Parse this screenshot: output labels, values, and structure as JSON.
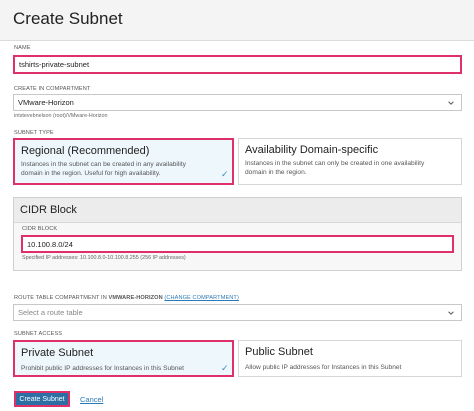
{
  "header": {
    "title": "Create Subnet"
  },
  "name": {
    "label": "NAME",
    "value": "tshirts-private-subnet"
  },
  "compartment": {
    "label": "CREATE IN COMPARTMENT",
    "value": "VMware-Horizon",
    "path": "intstevebnelson (root)/VMware-Horizon"
  },
  "subnet_type": {
    "label": "SUBNET TYPE",
    "options": [
      {
        "title": "Regional (Recommended)",
        "desc_1": "Instances in the subnet can be created in any availability",
        "desc_2": "domain in the region. Useful for high availability.",
        "selected": true
      },
      {
        "title": "Availability Domain-specific",
        "desc_1": "Instances in the subnet can only be created in one availability",
        "desc_2": "domain in the region.",
        "selected": false
      }
    ]
  },
  "cidr": {
    "section_title": "CIDR Block",
    "label": "CIDR BLOCK",
    "value": "10.100.8.0/24",
    "hint": "Specified IP addresses: 10.100.8.0-10.100.8.255 (256 IP addresses)"
  },
  "route_table": {
    "label": "ROUTE TABLE COMPARTMENT IN",
    "label_strong": "VMWARE-HORIZON",
    "change_link": "(CHANGE COMPARTMENT)",
    "placeholder": "Select a route table"
  },
  "subnet_access": {
    "label": "SUBNET ACCESS",
    "options": [
      {
        "title": "Private Subnet",
        "desc": "Prohibit public IP addresses for Instances in this Subnet",
        "selected": true
      },
      {
        "title": "Public Subnet",
        "desc": "Allow public IP addresses for Instances in this Subnet",
        "selected": false
      }
    ]
  },
  "buttons": {
    "create": "Create Subnet",
    "cancel": "Cancel"
  },
  "colors": {
    "highlight": "#e0306a",
    "primary": "#2c6fa5",
    "link": "#2c7bb6",
    "selected_bg": "#eef7fc"
  }
}
